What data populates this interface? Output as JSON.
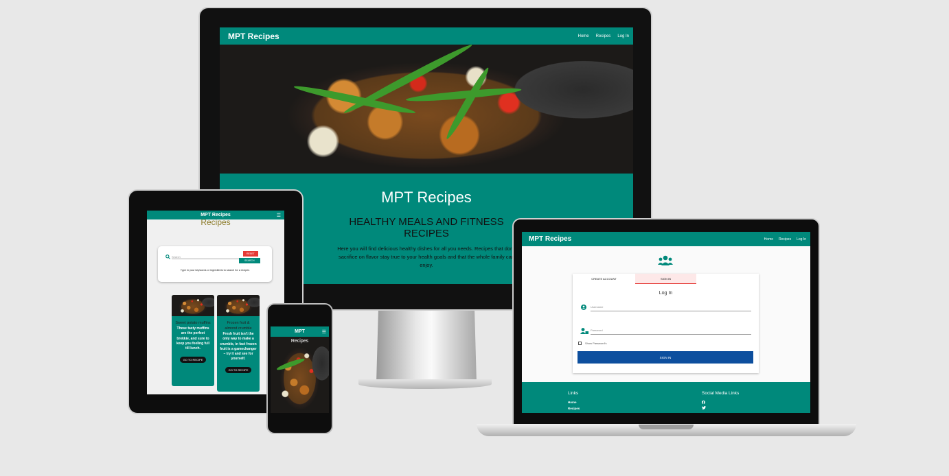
{
  "brand": "MPT Recipes",
  "nav": {
    "home": "Home",
    "recipes": "Recipes",
    "login": "Log In"
  },
  "monitor": {
    "hero_title": "MPT Recipes",
    "hero_subtitle": "HEALTHY MEALS AND FITNESS RECIPES",
    "hero_text": "Here you will find delicious healthy dishes for all you needs. Recipes that don't sacrifice on flavor stay true to your health goals and that the whole family can enjoy."
  },
  "tablet": {
    "page_title": "Recipes",
    "search_placeholder": "Search",
    "reset_label": "RESET",
    "search_label": "SEARCH",
    "search_hint": "Type in your keywords or ingredients to search for a recipes",
    "cards": [
      {
        "title": "Sweet potato muffins",
        "text": "These tasty muffins are the perfect brekkie, and sure to keep you feeling full till lunch.",
        "button": "GO TO RECIPE"
      },
      {
        "title": "Frozen fruit & almond crumble",
        "text": "Fresh fruit isn't the only way to make a crumble, in fact frozen fruit is a gamechanger – try it and see for yourself.",
        "button": "GO TO RECIPE"
      }
    ]
  },
  "phone": {
    "brand": "MPT",
    "heading": "Recipes"
  },
  "laptop": {
    "tab_create": "CREATE ACCOUNT",
    "tab_signin": "SIGN IN",
    "form_title": "Log In",
    "username_placeholder": "Username",
    "password_placeholder": "Password",
    "show_password": "Show Password's",
    "signin_button": "SIGN IN",
    "footer_links_title": "Links",
    "footer_links": [
      "Home",
      "Recipes"
    ],
    "footer_social_title": "Social Media Links"
  },
  "colors": {
    "teal": "#00897b",
    "blue_button": "#0d4f9e",
    "reset_red": "#e53935"
  }
}
